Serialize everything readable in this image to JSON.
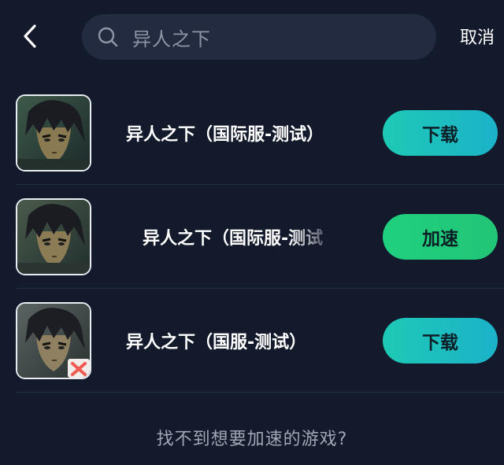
{
  "header": {
    "back_icon": "chevron-left-icon",
    "search": {
      "icon": "search-icon",
      "query": "异人之下"
    },
    "cancel_label": "取消"
  },
  "results": [
    {
      "name": "异人之下（国际服-测试）",
      "action": "下载",
      "action_type": "download",
      "badge": false
    },
    {
      "name": "异人之下（国际服-测试",
      "action": "加速",
      "action_type": "boost",
      "badge": false
    },
    {
      "name": "异人之下（国服-测试）",
      "action": "下载",
      "action_type": "download",
      "badge": true
    }
  ],
  "footer_hint": "找不到想要加速的游戏?",
  "colors": {
    "background": "#131a2c",
    "search_bg": "#222b3f",
    "download_btn": "#1ec9b5",
    "boost_btn": "#1fd07e"
  }
}
